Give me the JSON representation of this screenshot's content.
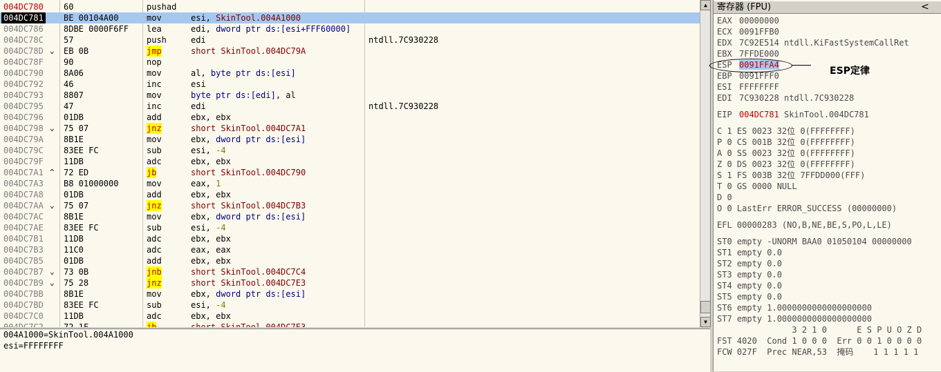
{
  "disassembly": [
    {
      "addr": "004DC780",
      "arrow": "",
      "hex": "60",
      "mn": "pushad",
      "ops": [],
      "cmt": ""
    },
    {
      "addr": "004DC781",
      "arrow": "",
      "hex": "BE 00104A00",
      "mn": "mov",
      "ops": [
        [
          "esi, ",
          "reg"
        ],
        [
          "SkinTool.004A1000",
          "sym"
        ]
      ],
      "cmt": ""
    },
    {
      "addr": "004DC786",
      "arrow": "",
      "hex": "8DBE 0000F6FF",
      "mn": "lea",
      "ops": [
        [
          "edi, ",
          "reg"
        ],
        [
          "dword ptr ds:[esi+FFF60000]",
          "kw"
        ]
      ],
      "cmt": ""
    },
    {
      "addr": "004DC78C",
      "arrow": "",
      "hex": "57",
      "mn": "push",
      "ops": [
        [
          "edi",
          "reg"
        ]
      ],
      "cmt": "ntdll.7C930228"
    },
    {
      "addr": "004DC78D",
      "arrow": "⌄",
      "hex": "EB 0B",
      "mn": "jmp",
      "ops": [
        [
          "short SkinTool.004DC79A",
          "sym"
        ]
      ],
      "cmt": ""
    },
    {
      "addr": "004DC78F",
      "arrow": "",
      "hex": "90",
      "mn": "nop",
      "ops": [],
      "cmt": ""
    },
    {
      "addr": "004DC790",
      "arrow": "",
      "hex": "8A06",
      "mn": "mov",
      "ops": [
        [
          "al, ",
          "reg"
        ],
        [
          "byte ptr ds:[esi]",
          "kw"
        ]
      ],
      "cmt": ""
    },
    {
      "addr": "004DC792",
      "arrow": "",
      "hex": "46",
      "mn": "inc",
      "ops": [
        [
          "esi",
          "reg"
        ]
      ],
      "cmt": ""
    },
    {
      "addr": "004DC793",
      "arrow": "",
      "hex": "8807",
      "mn": "mov",
      "ops": [
        [
          "byte ptr ds:[edi]",
          "kw"
        ],
        [
          ", al",
          "reg"
        ]
      ],
      "cmt": ""
    },
    {
      "addr": "004DC795",
      "arrow": "",
      "hex": "47",
      "mn": "inc",
      "ops": [
        [
          "edi",
          "reg"
        ]
      ],
      "cmt": "ntdll.7C930228"
    },
    {
      "addr": "004DC796",
      "arrow": "",
      "hex": "01DB",
      "mn": "add",
      "ops": [
        [
          "ebx, ebx",
          "reg"
        ]
      ],
      "cmt": ""
    },
    {
      "addr": "004DC798",
      "arrow": "⌄",
      "hex": "75 07",
      "mn": "jnz",
      "ops": [
        [
          "short SkinTool.004DC7A1",
          "sym"
        ]
      ],
      "cmt": ""
    },
    {
      "addr": "004DC79A",
      "arrow": "",
      "hex": "8B1E",
      "mn": "mov",
      "ops": [
        [
          "ebx, ",
          "reg"
        ],
        [
          "dword ptr ds:[esi]",
          "kw"
        ]
      ],
      "cmt": ""
    },
    {
      "addr": "004DC79C",
      "arrow": "",
      "hex": "83EE FC",
      "mn": "sub",
      "ops": [
        [
          "esi, ",
          "reg"
        ],
        [
          "-4",
          "num"
        ]
      ],
      "cmt": ""
    },
    {
      "addr": "004DC79F",
      "arrow": "",
      "hex": "11DB",
      "mn": "adc",
      "ops": [
        [
          "ebx, ebx",
          "reg"
        ]
      ],
      "cmt": ""
    },
    {
      "addr": "004DC7A1",
      "arrow": "^",
      "hex": "72 ED",
      "mn": "jb",
      "ops": [
        [
          "short SkinTool.004DC790",
          "sym"
        ]
      ],
      "cmt": ""
    },
    {
      "addr": "004DC7A3",
      "arrow": "",
      "hex": "B8 01000000",
      "mn": "mov",
      "ops": [
        [
          "eax, ",
          "reg"
        ],
        [
          "1",
          "num"
        ]
      ],
      "cmt": ""
    },
    {
      "addr": "004DC7A8",
      "arrow": "",
      "hex": "01DB",
      "mn": "add",
      "ops": [
        [
          "ebx, ebx",
          "reg"
        ]
      ],
      "cmt": ""
    },
    {
      "addr": "004DC7AA",
      "arrow": "⌄",
      "hex": "75 07",
      "mn": "jnz",
      "ops": [
        [
          "short SkinTool.004DC7B3",
          "sym"
        ]
      ],
      "cmt": ""
    },
    {
      "addr": "004DC7AC",
      "arrow": "",
      "hex": "8B1E",
      "mn": "mov",
      "ops": [
        [
          "ebx, ",
          "reg"
        ],
        [
          "dword ptr ds:[esi]",
          "kw"
        ]
      ],
      "cmt": ""
    },
    {
      "addr": "004DC7AE",
      "arrow": "",
      "hex": "83EE FC",
      "mn": "sub",
      "ops": [
        [
          "esi, ",
          "reg"
        ],
        [
          "-4",
          "num"
        ]
      ],
      "cmt": ""
    },
    {
      "addr": "004DC7B1",
      "arrow": "",
      "hex": "11DB",
      "mn": "adc",
      "ops": [
        [
          "ebx, ebx",
          "reg"
        ]
      ],
      "cmt": ""
    },
    {
      "addr": "004DC7B3",
      "arrow": "",
      "hex": "11C0",
      "mn": "adc",
      "ops": [
        [
          "eax, eax",
          "reg"
        ]
      ],
      "cmt": ""
    },
    {
      "addr": "004DC7B5",
      "arrow": "",
      "hex": "01DB",
      "mn": "add",
      "ops": [
        [
          "ebx, ebx",
          "reg"
        ]
      ],
      "cmt": ""
    },
    {
      "addr": "004DC7B7",
      "arrow": "⌄",
      "hex": "73 0B",
      "mn": "jnb",
      "ops": [
        [
          "short SkinTool.004DC7C4",
          "sym"
        ]
      ],
      "cmt": ""
    },
    {
      "addr": "004DC7B9",
      "arrow": "⌄",
      "hex": "75 28",
      "mn": "jnz",
      "ops": [
        [
          "short SkinTool.004DC7E3",
          "sym"
        ]
      ],
      "cmt": ""
    },
    {
      "addr": "004DC7BB",
      "arrow": "",
      "hex": "8B1E",
      "mn": "mov",
      "ops": [
        [
          "ebx, ",
          "reg"
        ],
        [
          "dword ptr ds:[esi]",
          "kw"
        ]
      ],
      "cmt": ""
    },
    {
      "addr": "004DC7BD",
      "arrow": "",
      "hex": "83EE FC",
      "mn": "sub",
      "ops": [
        [
          "esi, ",
          "reg"
        ],
        [
          "-4",
          "num"
        ]
      ],
      "cmt": ""
    },
    {
      "addr": "004DC7C0",
      "arrow": "",
      "hex": "11DB",
      "mn": "adc",
      "ops": [
        [
          "ebx, ebx",
          "reg"
        ]
      ],
      "cmt": ""
    },
    {
      "addr": "004DC7C2",
      "arrow": "",
      "hex": "72 1F",
      "mn": "jb",
      "ops": [
        [
          "short SkinTool.004DC7E3",
          "sym"
        ]
      ],
      "cmt": ""
    }
  ],
  "current_eip_addr": "004DC781",
  "jump_mnemonics": [
    "jmp",
    "jnz",
    "jb",
    "jnb"
  ],
  "info": {
    "line1": "004A1000=SkinTool.004A1000",
    "line2": "esi=FFFFFFFF"
  },
  "registers": {
    "title": "寄存器 (FPU)",
    "collapse_glyph": "<",
    "gp": [
      {
        "name": "EAX",
        "value": "00000000",
        "extra": ""
      },
      {
        "name": "ECX",
        "value": "0091FFB0",
        "extra": ""
      },
      {
        "name": "EDX",
        "value": "7C92E514",
        "extra": "ntdll.KiFastSystemCallRet"
      },
      {
        "name": "EBX",
        "value": "7FFDE000",
        "extra": ""
      },
      {
        "name": "ESP",
        "value": "0091FFA4",
        "extra": "",
        "highlight": true
      },
      {
        "name": "EBP",
        "value": "0091FFF0",
        "extra": ""
      },
      {
        "name": "ESI",
        "value": "FFFFFFFF",
        "extra": ""
      },
      {
        "name": "EDI",
        "value": "7C930228",
        "extra": "ntdll.7C930228"
      }
    ],
    "eip": {
      "name": "EIP",
      "value": "004DC781",
      "extra": "SkinTool.004DC781"
    },
    "flags": [
      "C 1  ES 0023 32位 0(FFFFFFFF)",
      "P 0  CS 001B 32位 0(FFFFFFFF)",
      "A 0  SS 0023 32位 0(FFFFFFFF)",
      "Z 0  DS 0023 32位 0(FFFFFFFF)",
      "S 1  FS 003B 32位 7FFDD000(FFF)",
      "T 0  GS 0000 NULL",
      "D 0",
      "O 0  LastErr ERROR_SUCCESS (00000000)"
    ],
    "efl": "EFL 00000283 (NO,B,NE,BE,S,PO,L,LE)",
    "fpu": [
      "ST0 empty -UNORM BAA0 01050104 00000000",
      "ST1 empty 0.0",
      "ST2 empty 0.0",
      "ST3 empty 0.0",
      "ST4 empty 0.0",
      "ST5 empty 0.0",
      "ST6 empty 1.0000000000000000000",
      "ST7 empty 1.0000000000000000000"
    ],
    "fst_header": "               3 2 1 0      E S P U O Z D",
    "fst": "FST 4020  Cond 1 0 0 0  Err 0 0 1 0 0 0 0",
    "fcw": "FCW 027F  Prec NEAR,53  掩码    1 1 1 1 1"
  },
  "annotation": {
    "text": "ESP定律"
  },
  "colors": {
    "pane_bg": "#fbf8ee",
    "selection": "#a6c8f0",
    "jump_highlight": "#ffff00",
    "address_red": "#c00000"
  }
}
